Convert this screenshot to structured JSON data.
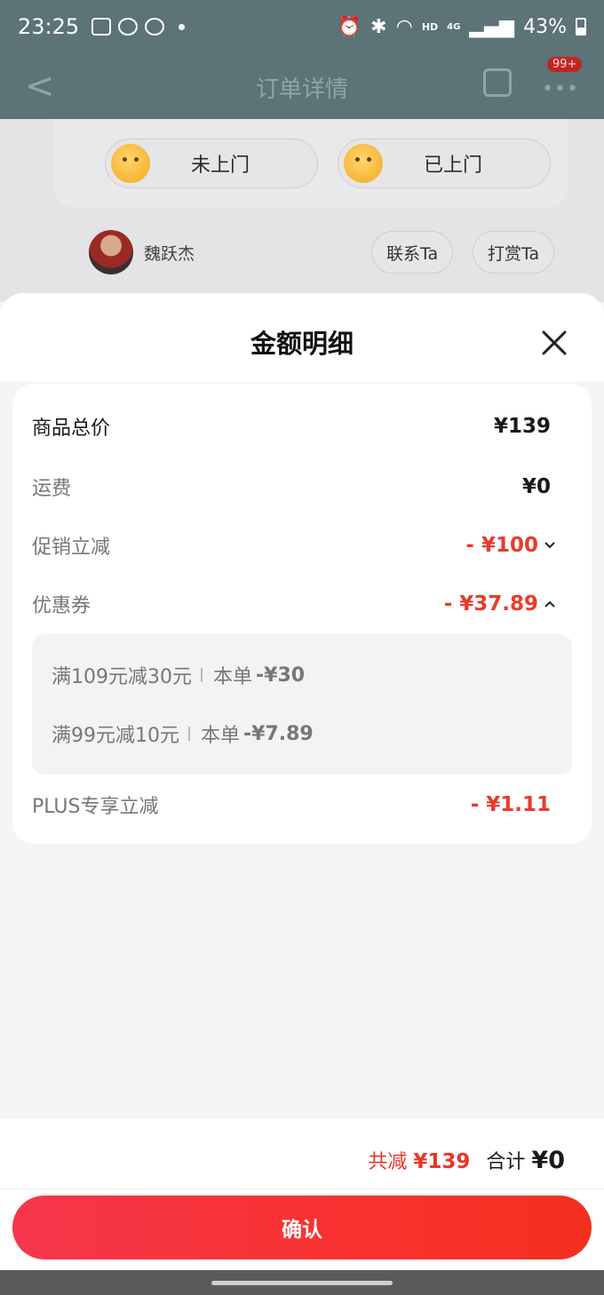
{
  "status_bar": {
    "time": "23:25",
    "hd": "HD",
    "network": "4G",
    "battery": "43%"
  },
  "background": {
    "nav_title": "订单详情",
    "nav_back_glyph": "<",
    "badge": "99+",
    "visit_buttons": [
      {
        "label": "未上门",
        "icon": "confused-face-icon"
      },
      {
        "label": "已上门",
        "icon": "laughing-face-icon"
      }
    ],
    "rider_name": "魏跃杰",
    "contact_label": "联系Ta",
    "tip_label": "打赏Ta"
  },
  "sheet": {
    "title": "金额明细",
    "rows": {
      "goods_total": {
        "label": "商品总价",
        "value": "¥139"
      },
      "shipping": {
        "label": "运费",
        "value": "¥0"
      },
      "promotion": {
        "label": "促销立减",
        "value": "- ¥100"
      },
      "coupon": {
        "label": "优惠券",
        "value": "- ¥37.89"
      },
      "plus": {
        "label": "PLUS专享立减",
        "value": "- ¥1.11"
      }
    },
    "coupons": [
      {
        "rule": "满109元减30元",
        "order_text": "本单",
        "amount": "-¥30"
      },
      {
        "rule": "满99元减10元",
        "order_text": "本单",
        "amount": "-¥7.89"
      }
    ]
  },
  "footer": {
    "reduce_label": "共减",
    "reduce_value": "¥139",
    "sum_label": "合计",
    "sum_value": "¥0",
    "confirm_label": "确认"
  },
  "colors": {
    "accent_red": "#ea3a2b",
    "statusbar_bg": "#5c7377",
    "confirm_gradient_start": "#f5364c",
    "confirm_gradient_end": "#f4301f"
  }
}
